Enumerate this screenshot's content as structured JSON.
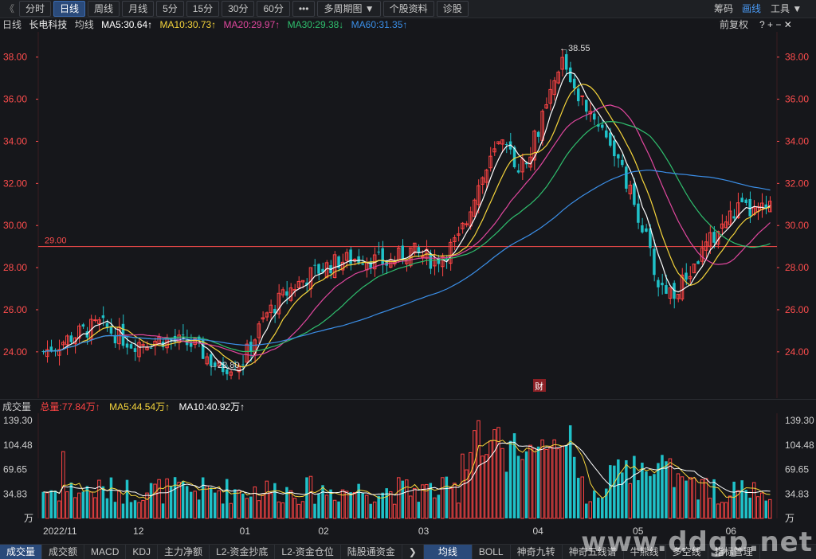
{
  "toolbar": {
    "back": "《",
    "tabs": [
      "分时",
      "日线",
      "周线",
      "月线",
      "5分",
      "15分",
      "30分",
      "60分",
      "•••",
      "多周期图 ▼",
      "个股资料",
      "诊股"
    ],
    "active_index": 1,
    "right": {
      "chips": "筹码",
      "draw": "画线",
      "tools": "工具 ▼",
      "icons": "⊕ ⊖ ✕"
    }
  },
  "legend": {
    "period": "日线",
    "stock_name": "长电科技",
    "ma_label": "均线",
    "ma5": "MA5:30.64↑",
    "ma10": "MA10:30.73↑",
    "ma20": "MA20:29.97↑",
    "ma30": "MA30:29.38↓",
    "ma60": "MA60:31.35↑",
    "adjust": "前复权",
    "icons": "? + − ✕"
  },
  "colors": {
    "up": "#ff4444",
    "down": "#1fc1c8",
    "ma5": "#ffffff",
    "ma10": "#f5d43b",
    "ma20": "#e0479e",
    "ma30": "#2fbf6e",
    "ma60": "#3b8fe8",
    "ref_line": "#ff4d4d"
  },
  "price_axis": {
    "ticks": [
      "38.00",
      "36.00",
      "34.00",
      "32.00",
      "30.00",
      "28.00",
      "26.00",
      "24.00"
    ],
    "min": 21.8,
    "max": 39.2
  },
  "annotations": {
    "high": "←38.55",
    "low": "←22.80",
    "ref": "29.00",
    "fin": "财"
  },
  "volume": {
    "title": "成交量",
    "total": "总量:77.84万↑",
    "ma5": "MA5:44.54万↑",
    "ma10": "MA10:40.92万↑",
    "ticks": [
      "139.30",
      "104.48",
      "69.65",
      "34.83"
    ],
    "unit": "万"
  },
  "time_axis": [
    "2022/11",
    "12",
    "01",
    "02",
    "03",
    "04",
    "05",
    "06"
  ],
  "bottom_tabs": [
    "成交量",
    "成交额",
    "MACD",
    "KDJ",
    "主力净额",
    "L2-资金抄底",
    "L2-资金仓位",
    "陆股通资金",
    "❯",
    "均线",
    "BOLL",
    "神奇九转",
    "神奇五线谱",
    "牛熊线",
    "多空线",
    "指标管理"
  ],
  "bottom_active": [
    0,
    9
  ],
  "watermark": "www.ddgp.net",
  "chart_data": {
    "type": "candlestick",
    "title": "长电科技 日线",
    "ylim": [
      21.8,
      39.2
    ],
    "reference_line": 29.0,
    "max_marker": 38.55,
    "min_marker": 22.8
  }
}
